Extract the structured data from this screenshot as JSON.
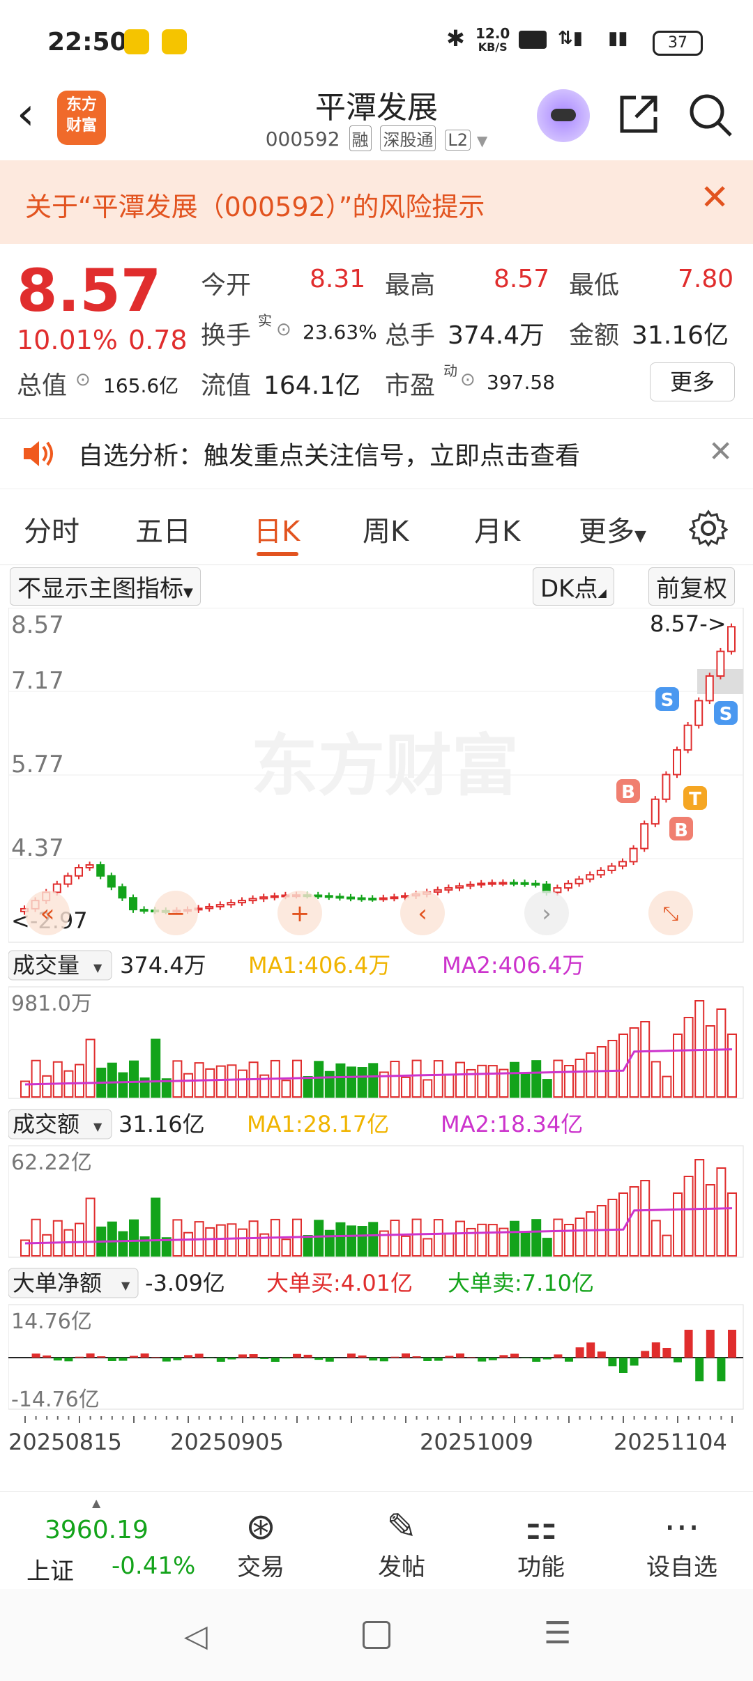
{
  "status": {
    "time": "22:50",
    "net_speed": "12.0",
    "net_unit": "KB/S",
    "battery": "37"
  },
  "header": {
    "logo_line1": "东方",
    "logo_line2": "财富",
    "title": "平潭发展",
    "code": "000592",
    "tags": [
      "融",
      "深股通",
      "L2"
    ]
  },
  "risk": {
    "text": "关于“平潭发展（000592）”的风险提示"
  },
  "quote": {
    "price": "8.57",
    "change_pct": "10.01%",
    "change": "0.78",
    "open_label": "今开",
    "open": "8.31",
    "high_label": "最高",
    "high": "8.57",
    "low_label": "最低",
    "low": "7.80",
    "turnover_label": "换手",
    "turnover_sup": "实",
    "turnover": "23.63%",
    "volume_label": "总手",
    "volume": "374.4万",
    "amount_label": "金额",
    "amount": "31.16亿",
    "mcap_label": "总值",
    "mcap": "165.6亿",
    "float_label": "流值",
    "float": "164.1亿",
    "pe_label": "市盈",
    "pe_sup": "动",
    "pe": "397.58",
    "more": "更多"
  },
  "notice": {
    "text": "自选分析：触发重点关注信号，立即点击查看"
  },
  "tabs": [
    "分时",
    "五日",
    "日K",
    "周K",
    "月K",
    "更多"
  ],
  "active_tab": "日K",
  "indicator": {
    "main": "不显示主图指标",
    "dk": "DK点",
    "fq": "前复权"
  },
  "kline": {
    "y_labels": [
      "8.57",
      "7.17",
      "5.77",
      "4.37"
    ],
    "max_label": "8.57->",
    "min_label": "<-2.97",
    "watermark": "东方财富"
  },
  "volume_panel": {
    "name": "成交量",
    "value": "374.4万",
    "ma1": "MA1:406.4万",
    "ma2": "MA2:406.4万",
    "max": "981.0万"
  },
  "amount_panel": {
    "name": "成交额",
    "value": "31.16亿",
    "ma1": "MA1:28.17亿",
    "ma2": "MA2:18.34亿",
    "max": "62.22亿"
  },
  "flow_panel": {
    "name": "大单净额",
    "value": "-3.09亿",
    "buy": "大单买:4.01亿",
    "sell": "大单卖:7.10亿",
    "top": "14.76亿",
    "bottom": "-14.76亿"
  },
  "dates": [
    "20250815",
    "20250905",
    "20251009",
    "20251104"
  ],
  "index": {
    "value": "3960.19",
    "name": "上证",
    "change": "-0.41%"
  },
  "bottom_nav": [
    "交易",
    "发帖",
    "功能",
    "设自选"
  ],
  "colors": {
    "up": "#e02d2d",
    "down": "#13a31a",
    "accent": "#e2531f",
    "ma1": "#f0b400",
    "ma2": "#cc33cc"
  }
}
